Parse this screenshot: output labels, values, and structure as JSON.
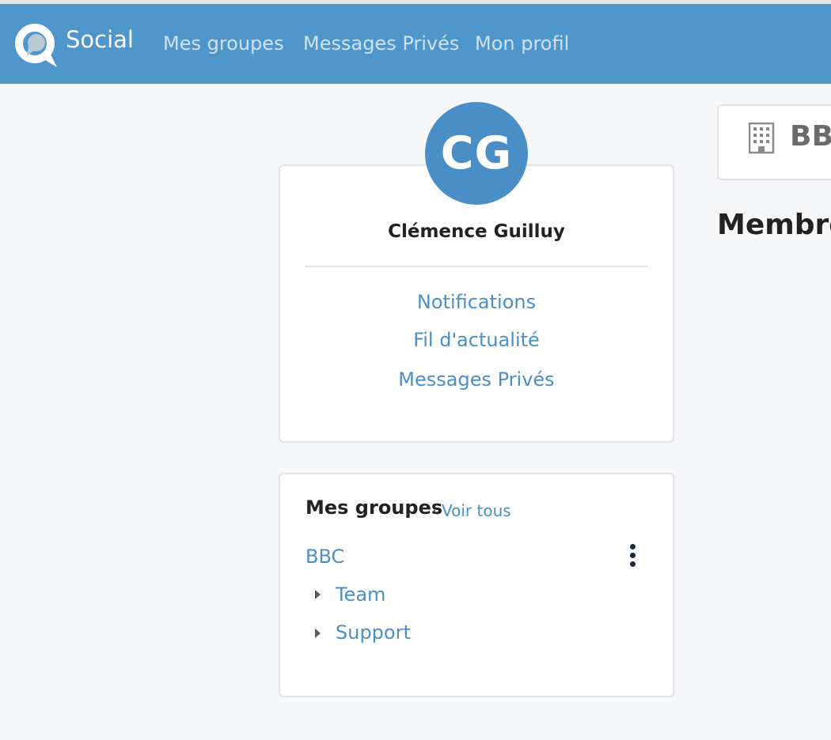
{
  "nav": {
    "brand": "Social",
    "links": [
      "Mes groupes",
      "Messages Privés",
      "Mon profil"
    ]
  },
  "profile": {
    "initials": "CG",
    "name": "Clémence Guilluy",
    "links": [
      "Notifications",
      "Fil d'actualité",
      "Messages Privés"
    ]
  },
  "groups": {
    "title": "Mes groupes",
    "separator": "·",
    "see_all": "Voir tous",
    "parent": "BBC",
    "subgroups": [
      "Team",
      "Support"
    ]
  },
  "group_header": {
    "name": "BBC",
    "icon": "building-icon"
  },
  "members": {
    "title": "Membres"
  },
  "colors": {
    "navbar": "#4e96cc",
    "avatar": "#4a8ec7",
    "link": "#4a90c4",
    "background": "#f6f7f9"
  }
}
